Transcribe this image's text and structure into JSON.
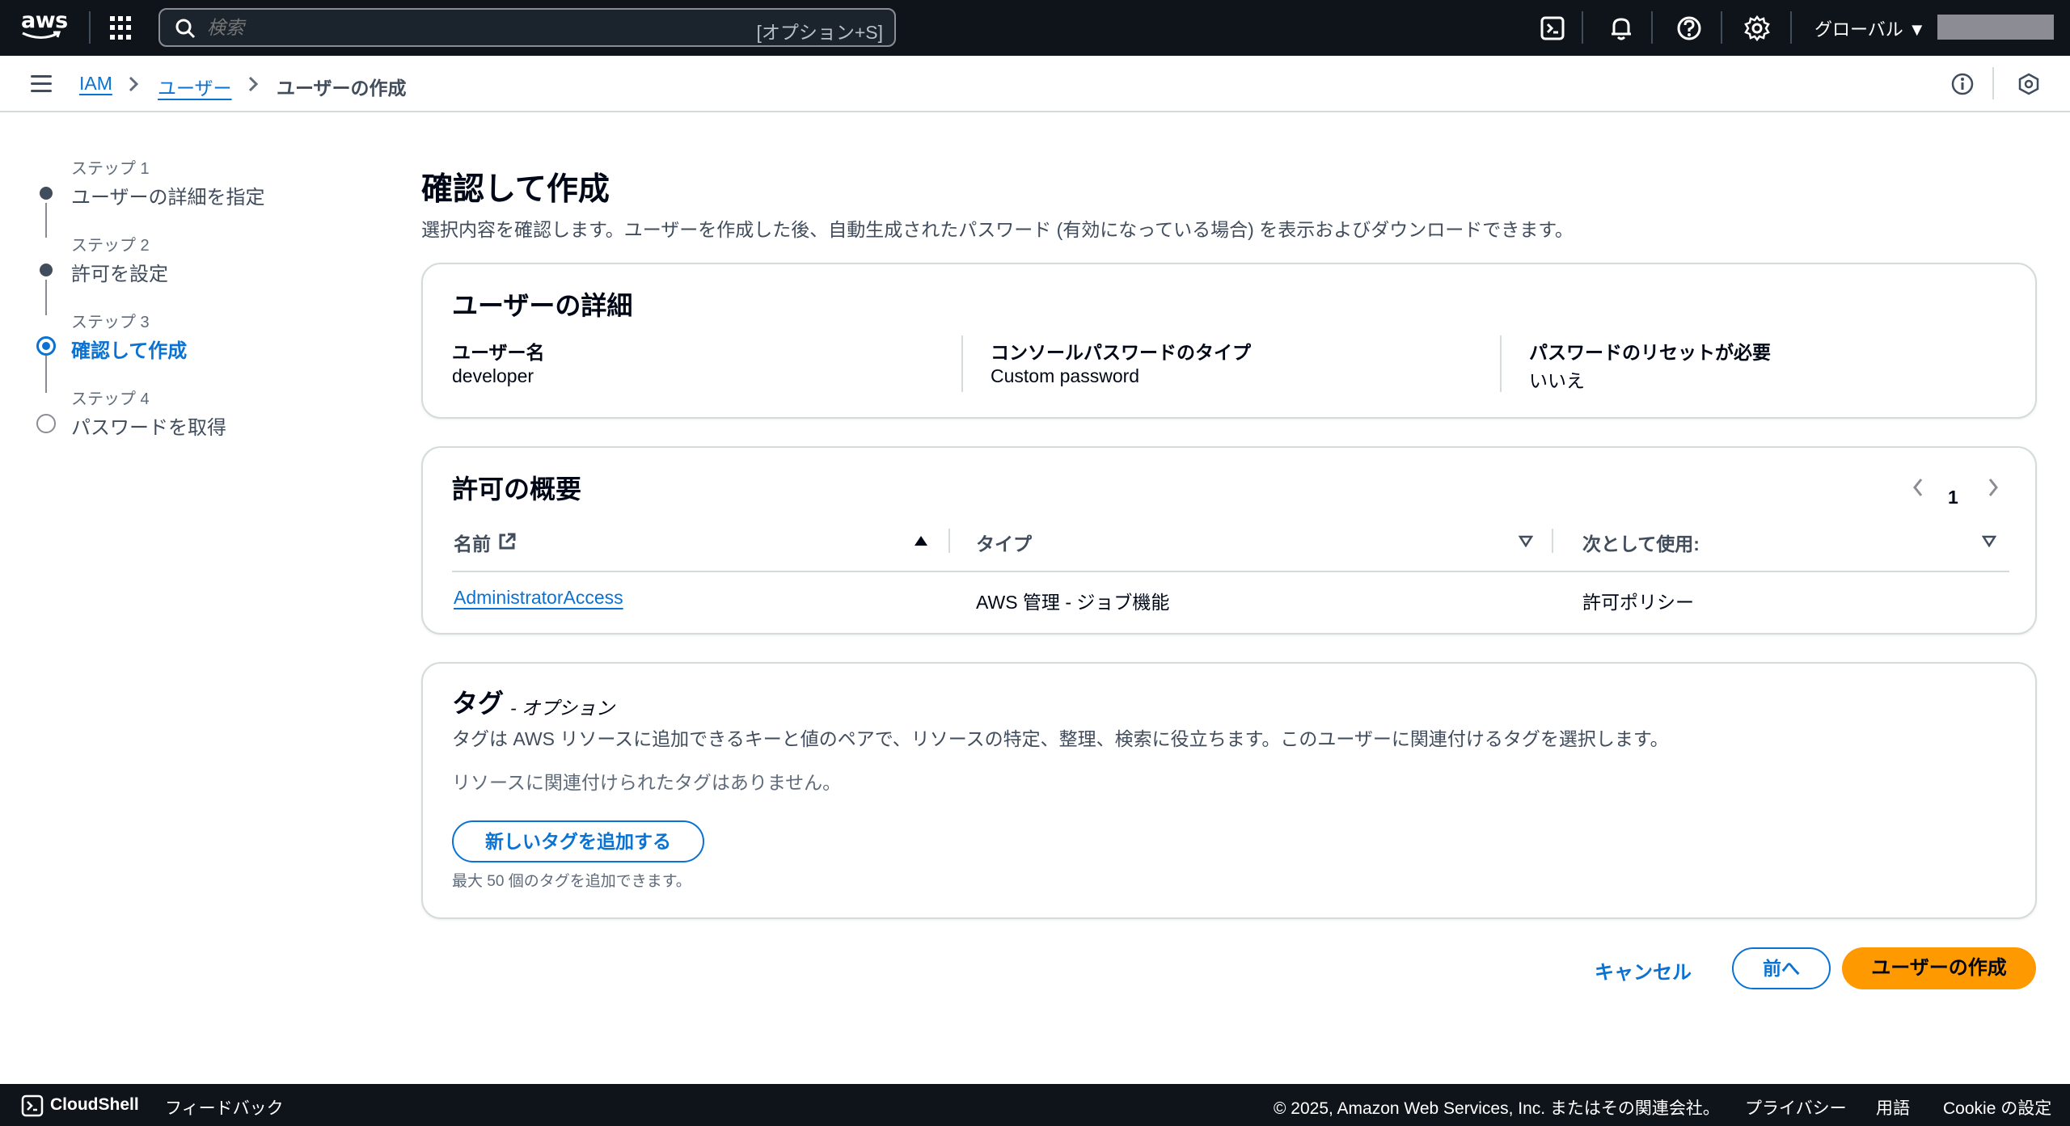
{
  "topnav": {
    "logo_text": "aws",
    "search_placeholder": "検索",
    "search_shortcut": "[オプション+S]",
    "region": "グローバル ▼",
    "icons": [
      "cloudshell-icon",
      "bell-icon",
      "help-icon",
      "settings-icon"
    ]
  },
  "breadcrumb": {
    "items": [
      "IAM",
      "ユーザー",
      "ユーザーの作成"
    ]
  },
  "steps": [
    {
      "label": "ステップ 1",
      "title": "ユーザーの詳細を指定",
      "state": "done"
    },
    {
      "label": "ステップ 2",
      "title": "許可を設定",
      "state": "done"
    },
    {
      "label": "ステップ 3",
      "title": "確認して作成",
      "state": "active"
    },
    {
      "label": "ステップ 4",
      "title": "パスワードを取得",
      "state": "todo"
    }
  ],
  "page": {
    "title": "確認して作成",
    "description": "選択内容を確認します。ユーザーを作成した後、自動生成されたパスワード (有効になっている場合) を表示およびダウンロードできます。"
  },
  "user_details": {
    "heading": "ユーザーの詳細",
    "fields": [
      {
        "label": "ユーザー名",
        "value": "developer"
      },
      {
        "label": "コンソールパスワードのタイプ",
        "value": "Custom password"
      },
      {
        "label": "パスワードのリセットが必要",
        "value": "いいえ"
      }
    ]
  },
  "permissions": {
    "heading": "許可の概要",
    "page": "1",
    "columns": [
      "名前",
      "タイプ",
      "次として使用:"
    ],
    "rows": [
      [
        "AdministratorAccess",
        "AWS 管理 - ジョブ機能",
        "許可ポリシー"
      ]
    ]
  },
  "tags": {
    "heading": "タグ",
    "optional": "- オプション",
    "description": "タグは AWS リソースに追加できるキーと値のペアで、リソースの特定、整理、検索に役立ちます。このユーザーに関連付けるタグを選択します。",
    "empty": "リソースに関連付けられたタグはありません。",
    "add_button": "新しいタグを追加する",
    "hint": "最大 50 個のタグを追加できます。"
  },
  "actions": {
    "cancel": "キャンセル",
    "previous": "前へ",
    "create": "ユーザーの作成"
  },
  "footer": {
    "cloudshell": "CloudShell",
    "feedback": "フィードバック",
    "copyright": "© 2025, Amazon Web Services, Inc. またはその関連会社。",
    "privacy": "プライバシー",
    "terms": "用語",
    "cookie": "Cookie の設定"
  },
  "colors": {
    "accent": "#0972d3",
    "primary_button": "#ff9900",
    "nav_bg": "#0f141a"
  }
}
